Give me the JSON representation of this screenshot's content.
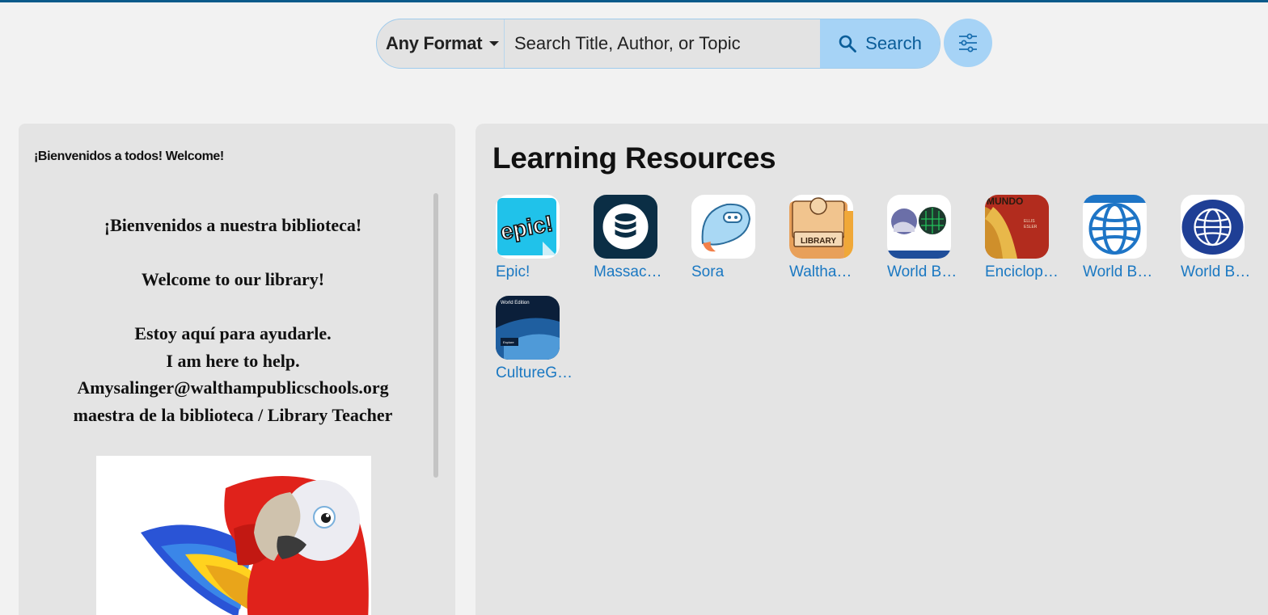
{
  "search": {
    "format_label": "Any Format",
    "placeholder": "Search Title, Author, or Topic",
    "button_label": "Search"
  },
  "welcome_panel": {
    "title": "¡Bienvenidos a todos! Welcome!",
    "lines": [
      "¡Bienvenidos a nuestra biblioteca!",
      "Welcome to our library!",
      "Estoy aquí para ayudarle.",
      "I am here to help.",
      "Amysalinger@walthampublicschools.org",
      "maestra de la biblioteca / Library Teacher"
    ]
  },
  "resources": {
    "title": "Learning Resources",
    "items": [
      {
        "label": "Epic!",
        "icon": "epic-logo-icon"
      },
      {
        "label": "Massac…",
        "icon": "database-icon"
      },
      {
        "label": "Sora",
        "icon": "sora-mascot-icon"
      },
      {
        "label": "Waltha…",
        "icon": "library-card-icon"
      },
      {
        "label": "World B…",
        "icon": "world-book-kids-icon"
      },
      {
        "label": "Enciclop…",
        "icon": "mundo-book-cover-icon"
      },
      {
        "label": "World B…",
        "icon": "globe-icon"
      },
      {
        "label": "World B…",
        "icon": "world-book-globe-icon"
      },
      {
        "label": "CultureG…",
        "icon": "culturegrams-icon"
      }
    ],
    "icon_tiny_text": {
      "epic": "epic!",
      "library": "LIBRARY",
      "mundo": "MUNDO",
      "ellis": "ELLIS",
      "esler": "ESLER",
      "culture": "World Edition",
      "explore": "Explore"
    }
  },
  "colors": {
    "accent": "#1a78c2",
    "search_button": "#a6d3f6",
    "panel": "#e4e4e4"
  }
}
